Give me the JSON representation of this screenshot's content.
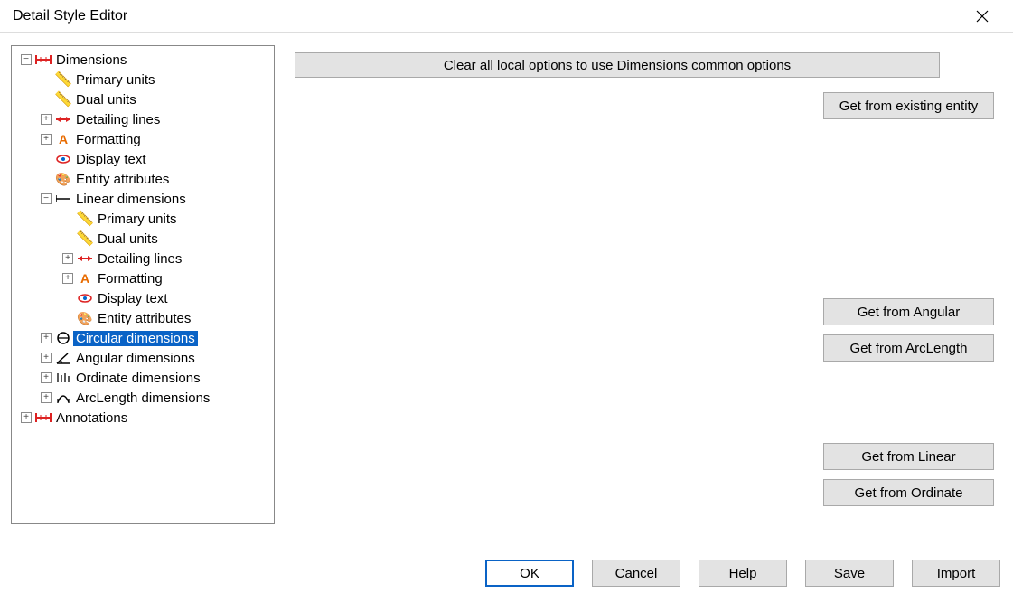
{
  "titlebar": {
    "title": "Detail Style Editor"
  },
  "tree": {
    "dimensions": {
      "label": "Dimensions",
      "primary_units": "Primary units",
      "dual_units": "Dual units",
      "detailing_lines": "Detailing lines",
      "formatting": "Formatting",
      "display_text": "Display text",
      "entity_attributes": "Entity attributes",
      "linear": {
        "label": "Linear dimensions",
        "primary_units": "Primary units",
        "dual_units": "Dual units",
        "detailing_lines": "Detailing lines",
        "formatting": "Formatting",
        "display_text": "Display text",
        "entity_attributes": "Entity attributes"
      },
      "circular": "Circular dimensions",
      "angular": "Angular dimensions",
      "ordinate": "Ordinate dimensions",
      "arclength": "ArcLength dimensions"
    },
    "annotations": "Annotations"
  },
  "rightPanel": {
    "clear_btn": "Clear all local options to use Dimensions common options",
    "get_existing": "Get from existing entity",
    "get_angular": "Get from Angular",
    "get_arclength": "Get from ArcLength",
    "get_linear": "Get from Linear",
    "get_ordinate": "Get from Ordinate"
  },
  "bottom": {
    "ok": "OK",
    "cancel": "Cancel",
    "help": "Help",
    "save": "Save",
    "import": "Import"
  }
}
